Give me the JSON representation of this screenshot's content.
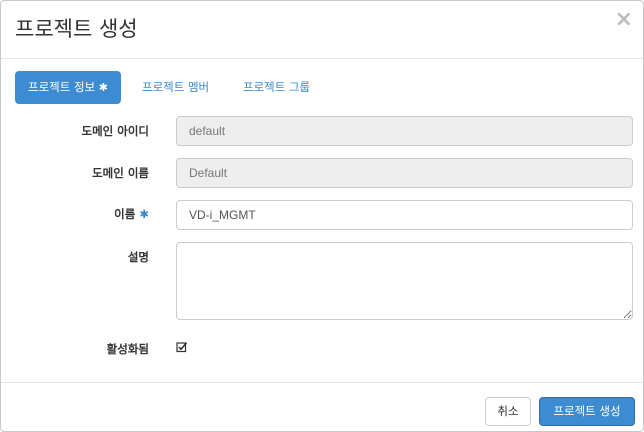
{
  "modal": {
    "title": "프로젝트 생성",
    "close_icon": "close-icon",
    "tabs": [
      {
        "label": "프로젝트 정보",
        "required_mark": "✱",
        "active": true
      },
      {
        "label": "프로젝트 멤버",
        "active": false
      },
      {
        "label": "프로젝트 그룹",
        "active": false
      }
    ],
    "fields": {
      "domain_id": {
        "label": "도메인 아이디",
        "value": "default"
      },
      "domain_name": {
        "label": "도메인 이름",
        "value": "Default"
      },
      "name": {
        "label": "이름",
        "required_mark": "✱",
        "value": "VD-i_MGMT"
      },
      "description": {
        "label": "설명",
        "value": ""
      },
      "enabled": {
        "label": "활성화됨",
        "checked": true
      }
    },
    "buttons": {
      "cancel": "취소",
      "submit": "프로젝트 생성"
    },
    "colors": {
      "primary": "#3d8bd0",
      "link": "#3a87c8"
    }
  }
}
